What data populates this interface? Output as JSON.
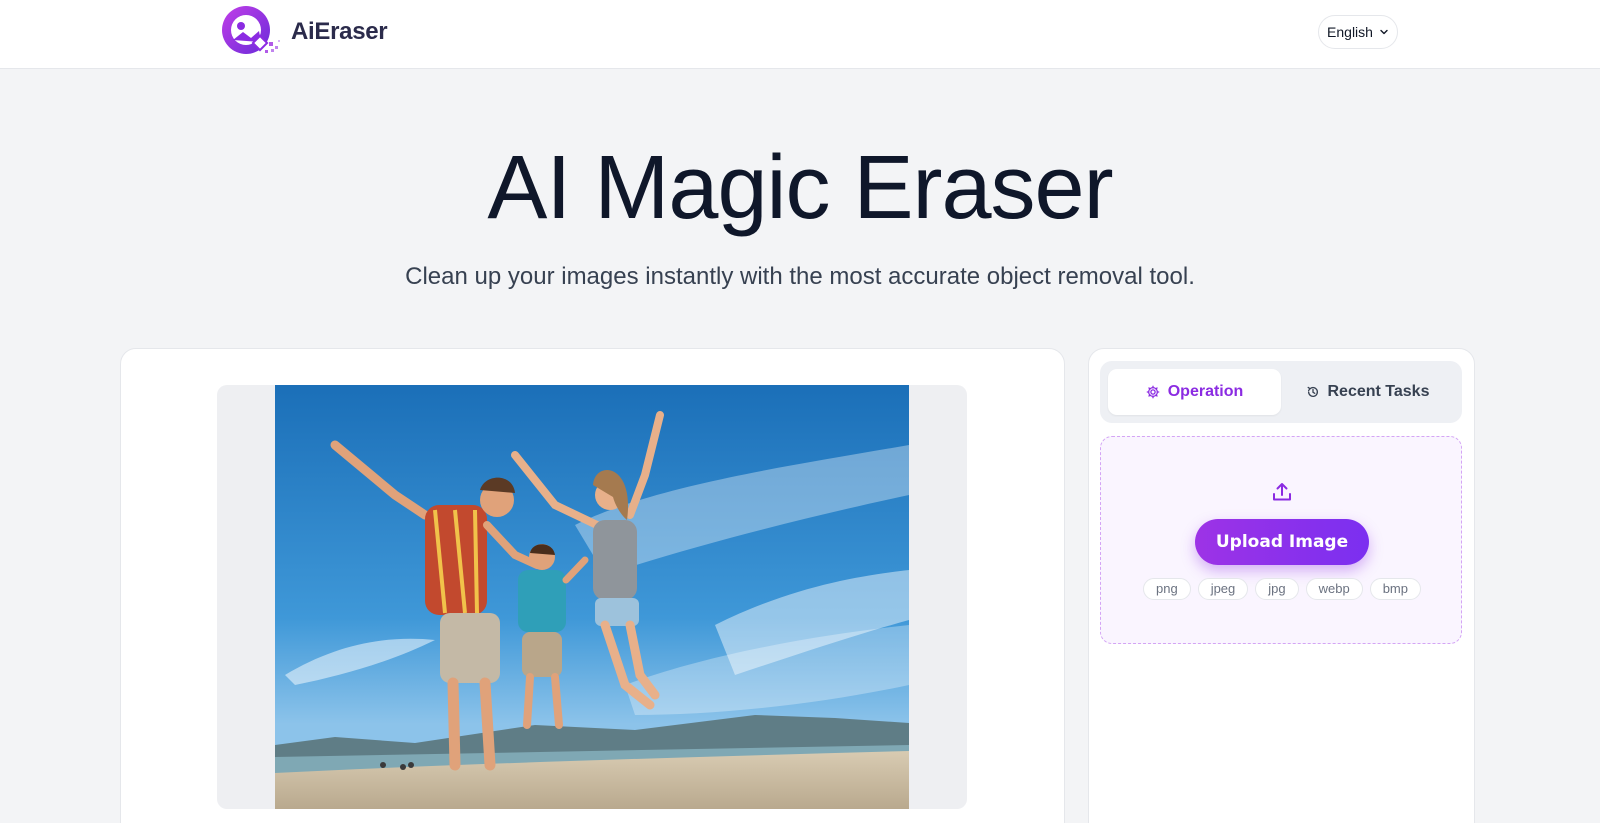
{
  "header": {
    "logo_text": "AiEraser",
    "language": "English"
  },
  "hero": {
    "title": "AI Magic Eraser",
    "subtitle": "Clean up your images instantly with the most accurate object removal tool."
  },
  "preview": {
    "image_alt": "sample-beach-photo"
  },
  "panel": {
    "tabs": [
      {
        "label": "Operation",
        "icon": "gear-icon",
        "active": true
      },
      {
        "label": "Recent Tasks",
        "icon": "history-icon",
        "active": false
      }
    ],
    "upload_label": "Upload Image",
    "formats": [
      "png",
      "jpeg",
      "jpg",
      "webp",
      "bmp"
    ]
  },
  "colors": {
    "accent": "#8b2be2",
    "dropzone_bg": "#faf5ff",
    "page_bg": "#f3f4f6"
  }
}
